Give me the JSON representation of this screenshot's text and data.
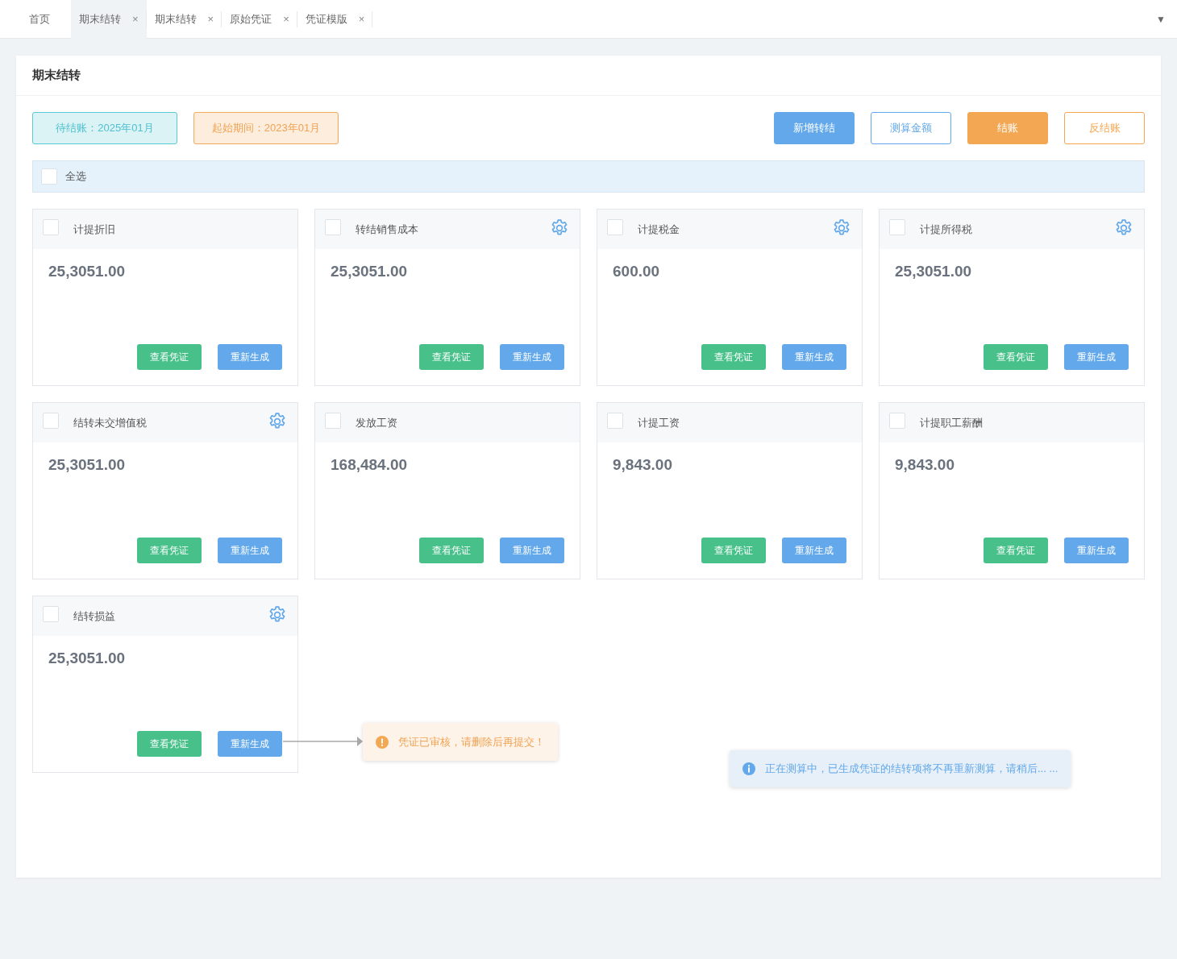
{
  "tabs": [
    {
      "label": "首页",
      "selected": false,
      "closable": false
    },
    {
      "label": "期末结转",
      "selected": true,
      "closable": true
    },
    {
      "label": "期末结转",
      "selected": false,
      "closable": true
    },
    {
      "label": "原始凭证",
      "selected": false,
      "closable": true
    },
    {
      "label": "凭证模版",
      "selected": false,
      "closable": true
    }
  ],
  "tab_close": "×",
  "tab_menu": "▼",
  "panel": {
    "title": "期末结转",
    "period_tags": [
      {
        "kind": "pending",
        "text": "待结账：2025年01月"
      },
      {
        "kind": "start",
        "text": "起始期间：2023年01月"
      }
    ],
    "actions": [
      {
        "kind": "primary",
        "label": "新增转结"
      },
      {
        "kind": "outline-primary",
        "label": "测算金额"
      },
      {
        "kind": "warning",
        "label": "结账"
      },
      {
        "kind": "outline-warning",
        "label": "反结账"
      }
    ],
    "select_all": {
      "label": "全选",
      "checked": false
    },
    "cards": [
      {
        "title": "计提折旧",
        "amount": "25,3051.00",
        "checked": false,
        "settings": false,
        "buttons": [
          "查看凭证",
          "重新生成"
        ]
      },
      {
        "title": "转结销售成本",
        "amount": "25,3051.00",
        "checked": false,
        "settings": true,
        "buttons": [
          "查看凭证",
          "重新生成"
        ]
      },
      {
        "title": "计提税金",
        "amount": "600.00",
        "checked": false,
        "settings": true,
        "buttons": [
          "查看凭证",
          "重新生成"
        ]
      },
      {
        "title": "计提所得税",
        "amount": "25,3051.00",
        "checked": false,
        "settings": true,
        "buttons": [
          "查看凭证",
          "重新生成"
        ]
      },
      {
        "title": "结转未交增值税",
        "amount": "25,3051.00",
        "checked": false,
        "settings": true,
        "buttons": [
          "查看凭证",
          "重新生成"
        ]
      },
      {
        "title": "发放工资",
        "amount": "168,484.00",
        "checked": false,
        "settings": false,
        "buttons": [
          "查看凭证",
          "重新生成"
        ]
      },
      {
        "title": "计提工资",
        "amount": "9,843.00",
        "checked": false,
        "settings": false,
        "buttons": [
          "查看凭证",
          "重新生成"
        ]
      },
      {
        "title": "计提职工薪酬",
        "amount": "9,843.00",
        "checked": false,
        "settings": false,
        "buttons": [
          "查看凭证",
          "重新生成"
        ]
      },
      {
        "title": "结转损益",
        "amount": "25,3051.00",
        "checked": false,
        "settings": true,
        "buttons": [
          "查看凭证",
          "重新生成"
        ]
      }
    ],
    "messages": [
      {
        "kind": "warning",
        "text": "凭证已审核，请删除后再提交！"
      },
      {
        "kind": "info",
        "text": "正在测算中，已生成凭证的结转项将不再重新测算，请稍后... ..."
      }
    ]
  }
}
